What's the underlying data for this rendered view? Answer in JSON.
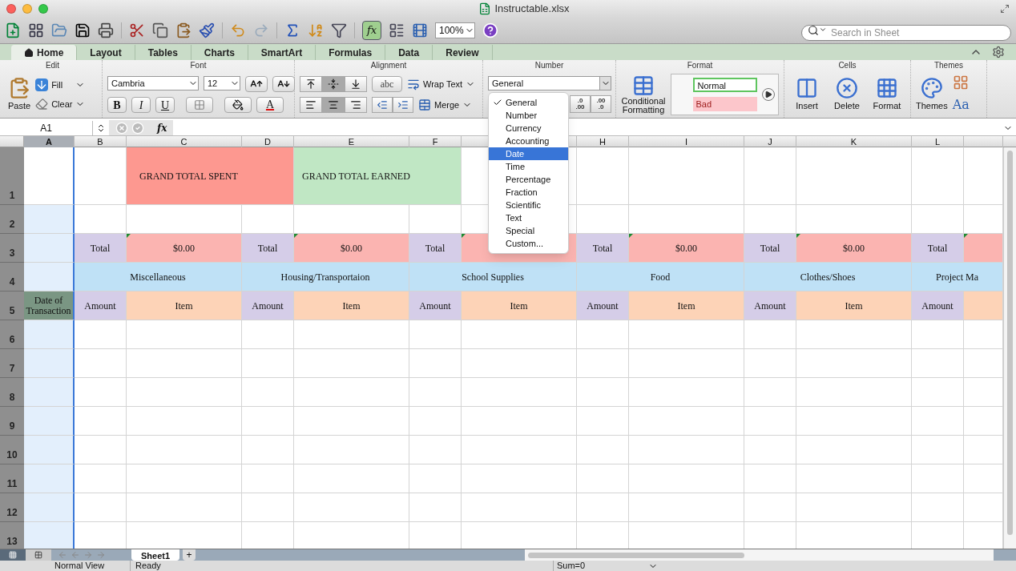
{
  "window": {
    "title": "Instructable.xlsx"
  },
  "toolbar": {
    "zoom": "100%",
    "formula_builder": {
      "label": "fx",
      "on": true
    },
    "search": {
      "placeholder": "Search in Sheet"
    }
  },
  "ribbon_tabs": [
    {
      "label": "Home",
      "selected": true
    },
    {
      "label": "Layout",
      "selected": false
    },
    {
      "label": "Tables",
      "selected": false
    },
    {
      "label": "Charts",
      "selected": false
    },
    {
      "label": "SmartArt",
      "selected": false
    },
    {
      "label": "Formulas",
      "selected": false
    },
    {
      "label": "Data",
      "selected": false
    },
    {
      "label": "Review",
      "selected": false
    }
  ],
  "ribbon": {
    "edit": {
      "title": "Edit",
      "paste": "Paste",
      "fill": "Fill",
      "clear": "Clear"
    },
    "font": {
      "title": "Font",
      "font_name": "Cambria",
      "font_size": "12",
      "bold": "B",
      "italic": "I",
      "underline": "U",
      "font_color": "A"
    },
    "alignment": {
      "title": "Alignment",
      "vertical_alignment": [
        {
          "selected": false
        },
        {
          "selected": true
        },
        {
          "selected": false
        }
      ],
      "horizontal_alignment": [
        {
          "selected": false
        },
        {
          "selected": true
        },
        {
          "selected": false
        }
      ],
      "orientation": "abc",
      "wrap_text": "Wrap Text",
      "merge": "Merge"
    },
    "number": {
      "title": "Number",
      "format": "General",
      "decimal_buttons": [
        {
          "top": ".0",
          "bottom": ".00"
        },
        {
          "top": ".00",
          "bottom": ".0"
        }
      ]
    },
    "format": {
      "title": "Format",
      "conditional_formatting": "Conditional Formatting",
      "styles": [
        {
          "label": "Normal",
          "kind": "normal"
        },
        {
          "label": "Bad",
          "kind": "bad"
        }
      ]
    },
    "cells": {
      "title": "Cells",
      "buttons": [
        "Insert",
        "Delete",
        "Format"
      ]
    },
    "themes": {
      "title": "Themes",
      "themes_button": "Themes",
      "fonts_button": "Aa"
    }
  },
  "formula_bar": {
    "name_box": "A1",
    "fx": "fx"
  },
  "number_format_menu": [
    {
      "label": "General",
      "checked": true,
      "highlighted": false
    },
    {
      "label": "Number",
      "checked": false,
      "highlighted": false
    },
    {
      "label": "Currency",
      "checked": false,
      "highlighted": false
    },
    {
      "label": "Accounting",
      "checked": false,
      "highlighted": false
    },
    {
      "label": "Date",
      "checked": false,
      "highlighted": true
    },
    {
      "label": "Time",
      "checked": false,
      "highlighted": false
    },
    {
      "label": "Percentage",
      "checked": false,
      "highlighted": false
    },
    {
      "label": "Fraction",
      "checked": false,
      "highlighted": false
    },
    {
      "label": "Scientific",
      "checked": false,
      "highlighted": false
    },
    {
      "label": "Text",
      "checked": false,
      "highlighted": false
    },
    {
      "label": "Special",
      "checked": false,
      "highlighted": false
    },
    {
      "label": "Custom...",
      "checked": false,
      "highlighted": false
    }
  ],
  "sheet": {
    "columns": [
      {
        "label": "A",
        "selected": true
      },
      {
        "label": "B",
        "selected": false
      },
      {
        "label": "C",
        "selected": false
      },
      {
        "label": "D",
        "selected": false
      },
      {
        "label": "E",
        "selected": false
      },
      {
        "label": "F",
        "selected": false
      },
      {
        "selected": false
      },
      {
        "label": "H",
        "selected": false
      },
      {
        "label": "I",
        "selected": false
      },
      {
        "label": "J",
        "selected": false
      },
      {
        "label": "K",
        "selected": false
      },
      {
        "label": "L",
        "selected": false
      }
    ],
    "rows": [
      {
        "number": "1",
        "cells": [
          {
            "kind": "active"
          },
          {
            "kind": "blank"
          },
          {
            "kind": "spent",
            "text": "GRAND TOTAL SPENT"
          },
          {
            "kind": "earned",
            "text": "GRAND TOTAL EARNED"
          }
        ]
      },
      {
        "number": "2"
      },
      {
        "number": "3",
        "cells": [
          {
            "kind": "blank"
          },
          {
            "kind": "total_label",
            "text": "Total"
          },
          {
            "kind": "total_value",
            "text": "$0.00"
          },
          {
            "kind": "total_label",
            "text": "Total"
          },
          {
            "kind": "total_value",
            "text": "$0.00"
          },
          {
            "kind": "total_label",
            "text": "Total"
          },
          {
            "kind": "total_value"
          },
          {
            "kind": "total_label",
            "text": "Total"
          },
          {
            "kind": "total_value",
            "text": "$0.00"
          },
          {
            "kind": "total_label",
            "text": "Total"
          },
          {
            "kind": "total_value",
            "text": "$0.00"
          },
          {
            "kind": "total_label",
            "text": "Total"
          },
          {
            "kind": "total_value"
          }
        ]
      },
      {
        "number": "4",
        "cells": [
          {
            "kind": "blank"
          },
          {
            "kind": "category",
            "text": "Miscellaneous"
          },
          {
            "kind": "category",
            "text": "Housing/Transportaion"
          },
          {
            "kind": "category",
            "text": "School Supplies"
          },
          {
            "kind": "category",
            "text": "Food"
          },
          {
            "kind": "category",
            "text": "Clothes/Shoes"
          },
          {
            "kind": "category",
            "text": "Project Ma"
          }
        ]
      },
      {
        "number": "5",
        "cells": [
          {
            "kind": "date_header",
            "text": "Date of Transaction"
          },
          {
            "kind": "amount",
            "text": "Amount"
          },
          {
            "kind": "item",
            "text": "Item"
          },
          {
            "kind": "amount",
            "text": "Amount"
          },
          {
            "kind": "item",
            "text": "Item"
          },
          {
            "kind": "amount",
            "text": "Amount"
          },
          {
            "kind": "item",
            "text": "Item"
          },
          {
            "kind": "amount",
            "text": "Amount"
          },
          {
            "kind": "item",
            "text": "Item"
          },
          {
            "kind": "amount",
            "text": "Amount"
          },
          {
            "kind": "item",
            "text": "Item"
          },
          {
            "kind": "amount",
            "text": "Amount"
          },
          {
            "kind": "item"
          }
        ]
      },
      {
        "number": "6"
      },
      {
        "number": "7"
      },
      {
        "number": "8"
      },
      {
        "number": "9"
      },
      {
        "number": "10"
      },
      {
        "number": "11"
      },
      {
        "number": "12"
      },
      {
        "number": "13"
      }
    ]
  },
  "sheet_tabs": [
    {
      "label": "Sheet1",
      "selected": true
    }
  ],
  "add_sheet": "+",
  "status_bar": {
    "view": "Normal View",
    "status": "Ready",
    "sum": "Sum=0"
  }
}
